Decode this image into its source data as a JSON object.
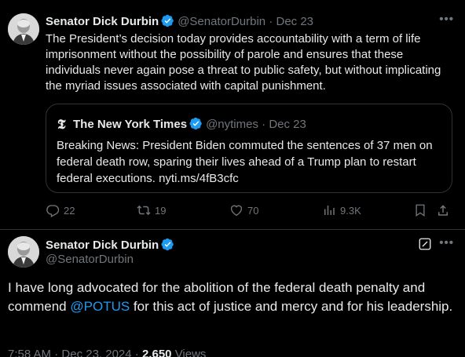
{
  "quoted_by_tweet": {
    "author_name": "Senator Dick Durbin",
    "author_handle": "@SenatorDurbin",
    "separator": "·",
    "date": "Dec 23",
    "text": "The President’s decision today provides accountability with a term of life imprisonment without the possibility of parole and ensures that these individuals never again pose a threat to public safety, but without implicating the myriad issues associated with capital punishment.",
    "quote": {
      "author_name": "The New York Times",
      "author_handle": "@nytimes",
      "separator": "·",
      "date": "Dec 23",
      "text": "Breaking News: President Biden commuted the sentences of 37 men on federal death row, sparing their lives ahead of a Trump plan to restart federal executions. nyti.ms/4fB3cfc"
    },
    "actions": {
      "replies": "22",
      "reposts": "19",
      "likes": "70",
      "views": "9.3K"
    }
  },
  "main_tweet": {
    "author_name": "Senator Dick Durbin",
    "author_handle": "@SenatorDurbin",
    "text_before_mention": "I have long advocated for the abolition of the federal death penalty and commend ",
    "mention": "@POTUS",
    "text_after_mention": " for this act of justice and mercy and for his leadership.",
    "time": "7:58 AM",
    "separator": "·",
    "date": "Dec 23, 2024",
    "separator2": "·",
    "views_count": "2,650",
    "views_label": "Views"
  },
  "colors": {
    "background": "#000000",
    "text": "#e7e9ea",
    "muted": "#71767b",
    "accent": "#1d9bf0",
    "border": "#2f3336"
  }
}
